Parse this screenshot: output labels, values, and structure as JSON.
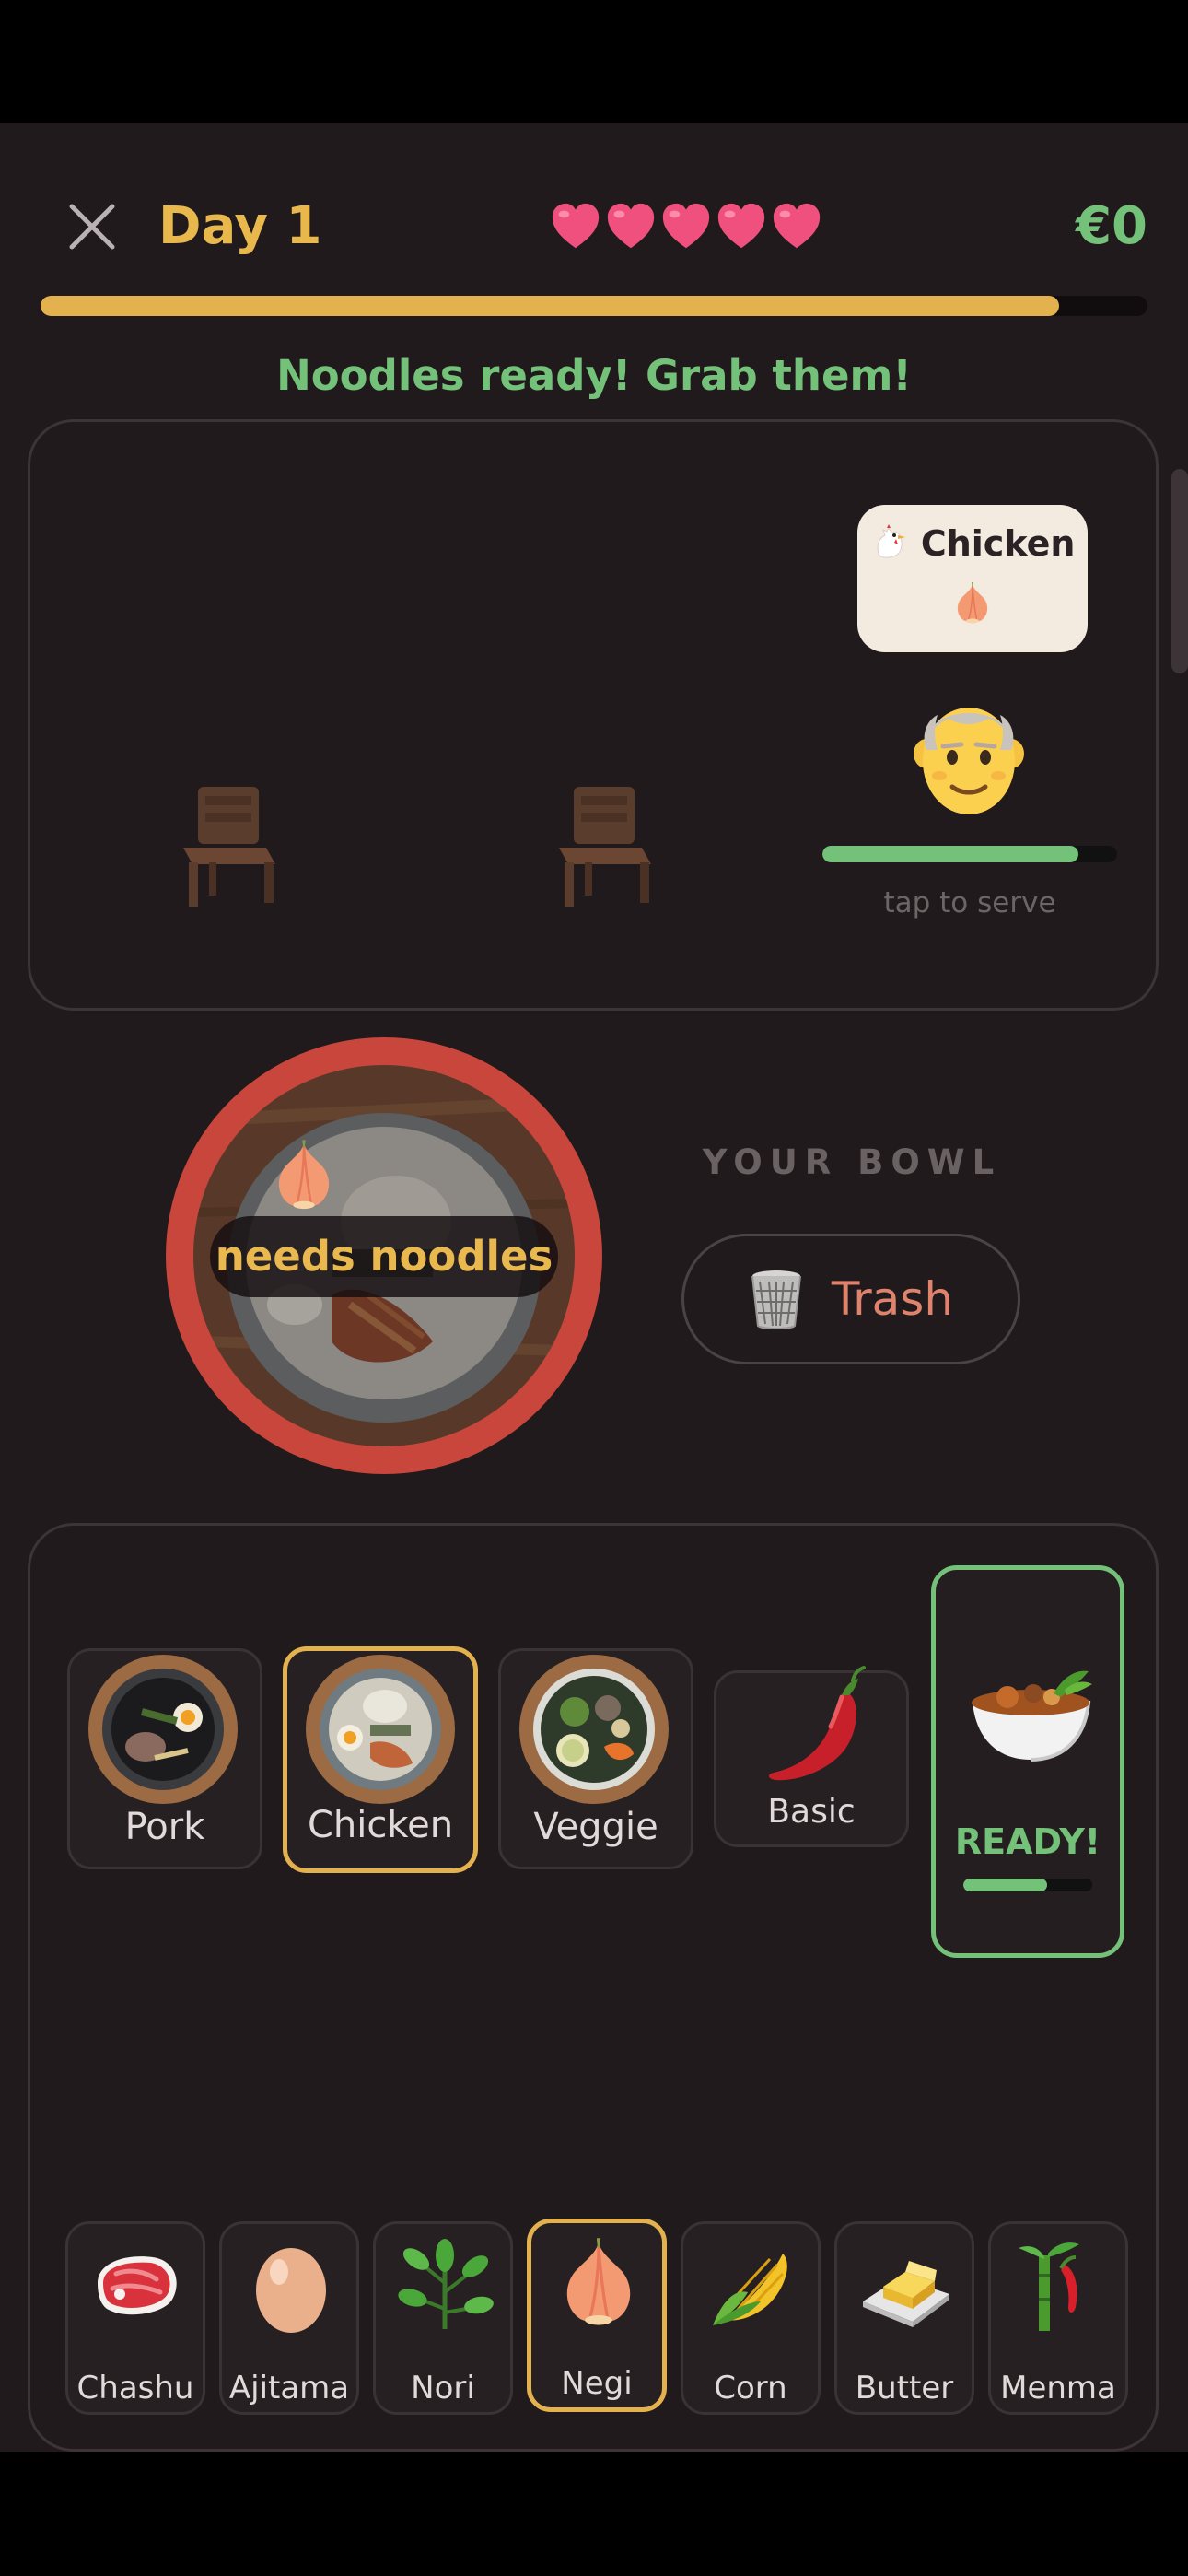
{
  "header": {
    "day_label": "Day 1",
    "lives": 5,
    "money": "€0",
    "day_timer_fraction": 0.92
  },
  "status_message": "Noodles ready! Grab them!",
  "counter": {
    "seats": [
      {
        "state": "empty",
        "icon": "chair-icon"
      },
      {
        "state": "empty",
        "icon": "chair-icon"
      },
      {
        "state": "occupied",
        "customer_icon": "old-man-face-icon",
        "order": {
          "broth": "Chicken",
          "broth_icon": "chicken-icon",
          "toppings": [
            "onion-icon"
          ]
        },
        "patience_fraction": 0.87,
        "hint": "tap to serve"
      }
    ]
  },
  "bowl": {
    "topping_icon": "onion-icon",
    "status": "needs noodles",
    "heading": "YOUR BOWL",
    "trash_label": "Trash",
    "trash_icon": "wastebasket-icon"
  },
  "broths": [
    {
      "label": "Pork",
      "icon": "pork-ramen-icon",
      "selected": false
    },
    {
      "label": "Chicken",
      "icon": "chicken-ramen-icon",
      "selected": true
    },
    {
      "label": "Veggie",
      "icon": "veggie-bowl-icon",
      "selected": false
    },
    {
      "label": "Basic",
      "icon": "chili-pepper-icon",
      "selected": false
    }
  ],
  "noodles": {
    "label": "READY!",
    "icon": "noodle-pot-icon",
    "progress_fraction": 0.65
  },
  "toppings": [
    {
      "label": "Chashu",
      "icon": "meat-icon",
      "selected": false
    },
    {
      "label": "Ajitama",
      "icon": "egg-icon",
      "selected": false
    },
    {
      "label": "Nori",
      "icon": "herb-icon",
      "selected": false
    },
    {
      "label": "Negi",
      "icon": "onion-icon",
      "selected": true
    },
    {
      "label": "Corn",
      "icon": "corn-icon",
      "selected": false
    },
    {
      "label": "Butter",
      "icon": "butter-icon",
      "selected": false
    },
    {
      "label": "Menma",
      "icon": "bamboo-icon",
      "selected": false
    }
  ],
  "colors": {
    "background": "#201a1c",
    "accent_gold": "#e3b24e",
    "accent_green": "#74c27a",
    "bowl_ring_red": "#c8463b",
    "trash_text": "#e0836d"
  }
}
